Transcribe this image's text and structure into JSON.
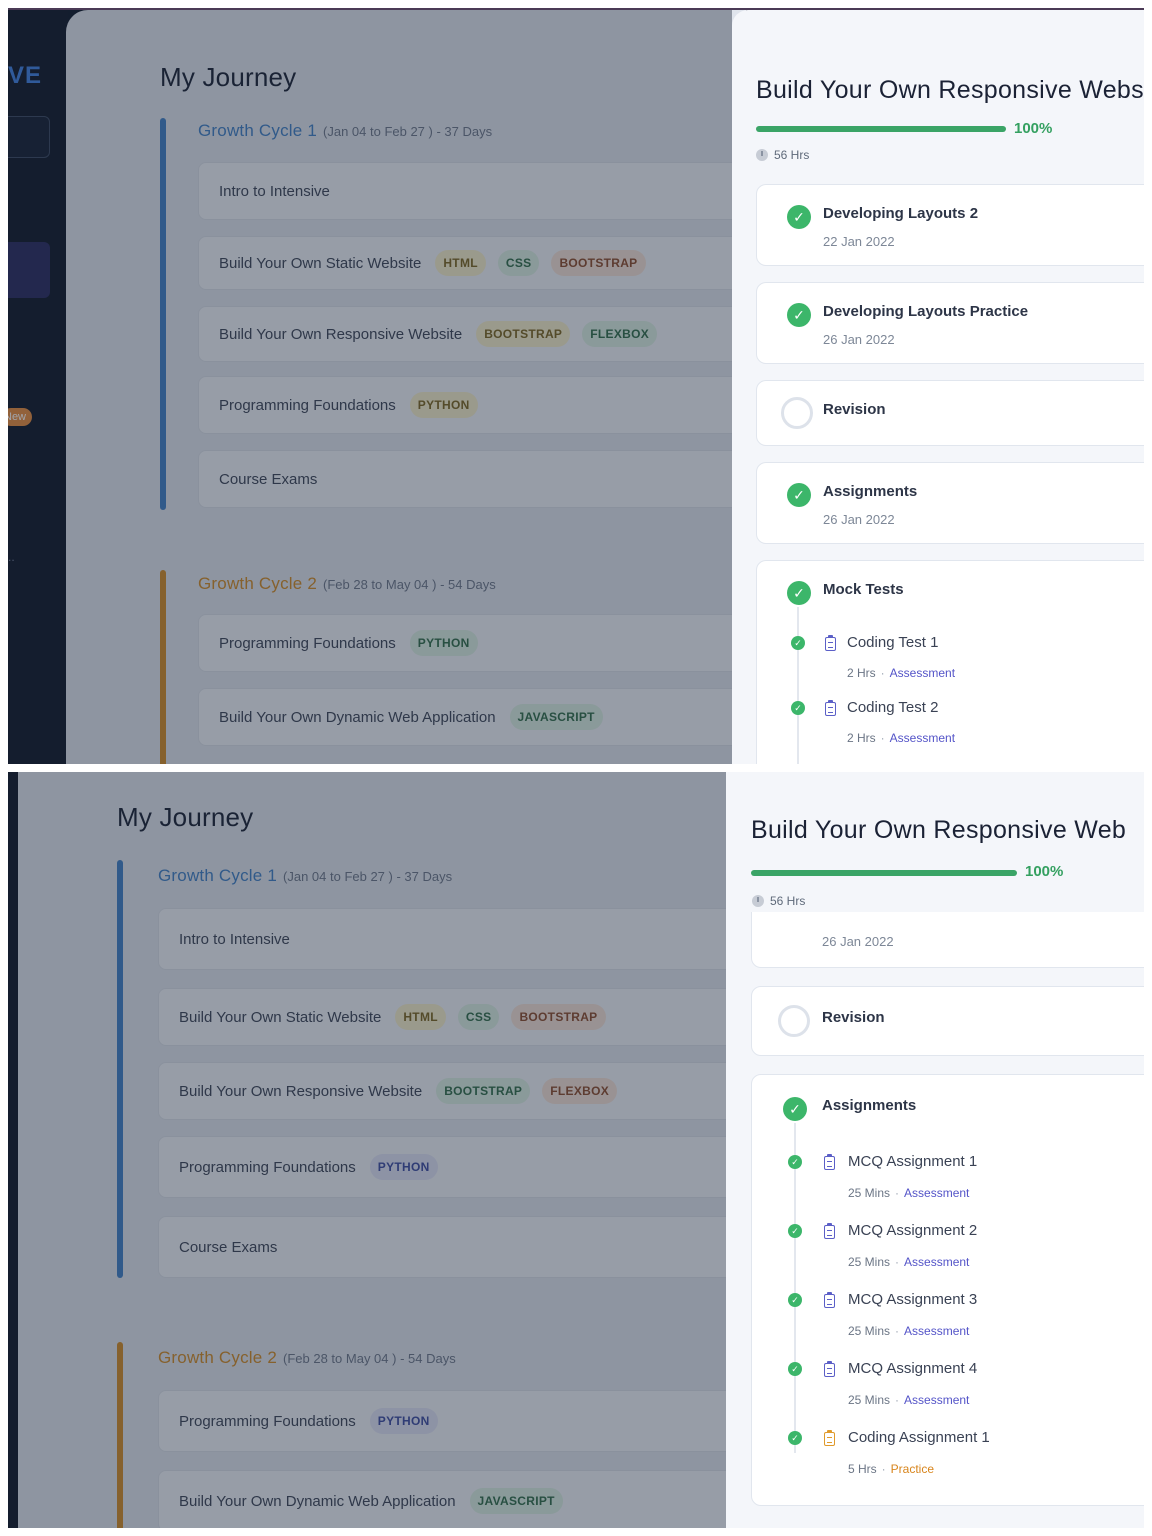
{
  "sidebar": {
    "logo_text": "VE",
    "new_badge": "New",
    "dots": ".."
  },
  "journey": {
    "title": "My Journey",
    "cycles": [
      {
        "name": "Growth Cycle 1",
        "dates": "(Jan 04 to Feb 27 ) - 37 Days",
        "color": "#3f7fc4",
        "courses": [
          {
            "name": "Intro to Intensive",
            "tags": []
          },
          {
            "name": "Build Your Own Static Website",
            "tags": [
              "HTML",
              "CSS",
              "BOOTSTRAP"
            ]
          },
          {
            "name": "Build Your Own Responsive Website",
            "tags": [
              "BOOTSTRAP",
              "FLEXBOX"
            ]
          },
          {
            "name": "Programming Foundations",
            "tags": [
              "PYTHON"
            ]
          },
          {
            "name": "Course Exams",
            "tags": []
          }
        ]
      },
      {
        "name": "Growth Cycle 2",
        "dates": "(Feb 28 to May 04 ) - 54 Days",
        "color": "#d08a25",
        "courses": [
          {
            "name": "Programming Foundations",
            "tags": [
              "PYTHON"
            ]
          },
          {
            "name": "Build Your Own Dynamic Web Application",
            "tags": [
              "JAVASCRIPT"
            ]
          }
        ]
      }
    ]
  },
  "panel": {
    "title_1": "Build Your Own Responsive Webs",
    "title_2": "Build Your Own Responsive Web",
    "progress": 1.0,
    "progress_label": "100%",
    "hours": "56 Hrs",
    "modules": {
      "dev_layouts_2": {
        "title": "Developing Layouts 2",
        "date": "22 Jan 2022"
      },
      "dev_layouts_practice": {
        "title": "Developing Layouts Practice",
        "date": "26 Jan 2022"
      },
      "revision": {
        "title": "Revision"
      },
      "assignments": {
        "title": "Assignments",
        "date": "26 Jan 2022"
      },
      "mock_tests": {
        "title": "Mock Tests"
      },
      "partial_date": "26 Jan 2022"
    },
    "mock_tests_items": [
      {
        "title": "Coding Test 1",
        "duration": "2 Hrs",
        "type": "Assessment"
      },
      {
        "title": "Coding Test 2",
        "duration": "2 Hrs",
        "type": "Assessment"
      }
    ],
    "assignment_items": [
      {
        "title": "MCQ Assignment 1",
        "duration": "25 Mins",
        "type": "Assessment"
      },
      {
        "title": "MCQ Assignment 2",
        "duration": "25 Mins",
        "type": "Assessment"
      },
      {
        "title": "MCQ Assignment 3",
        "duration": "25 Mins",
        "type": "Assessment"
      },
      {
        "title": "MCQ Assignment 4",
        "duration": "25 Mins",
        "type": "Assessment"
      },
      {
        "title": "Coding Assignment 1",
        "duration": "5 Hrs",
        "type": "Practice"
      }
    ],
    "meta_separator": "·"
  },
  "colors": {
    "cycle1": "#3f7fc4",
    "cycle2": "#d08a25",
    "progress": "#3aa466",
    "check": "#3cb66a",
    "assessment": "#5454c8",
    "practice": "#d8851c"
  },
  "icons": {
    "check": "✓",
    "clock": "clock-icon",
    "assignment": "clipboard-icon"
  }
}
